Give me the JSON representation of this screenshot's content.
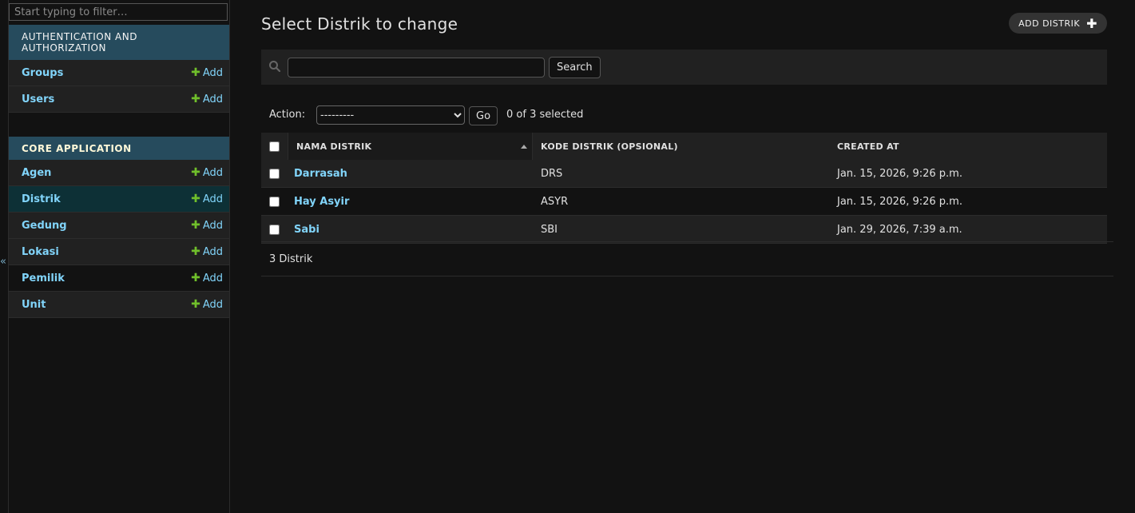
{
  "sidebar": {
    "filter_placeholder": "Start typing to filter…",
    "collapse_glyph": "«",
    "modules": [
      {
        "title": "AUTHENTICATION AND AUTHORIZATION",
        "models": [
          {
            "name": "Groups",
            "add": "Add"
          },
          {
            "name": "Users",
            "add": "Add"
          }
        ]
      },
      {
        "title": "CORE APPLICATION",
        "models": [
          {
            "name": "Agen",
            "add": "Add"
          },
          {
            "name": "Distrik",
            "add": "Add",
            "current": true
          },
          {
            "name": "Gedung",
            "add": "Add"
          },
          {
            "name": "Lokasi",
            "add": "Add"
          },
          {
            "name": "Pemilik",
            "add": "Add"
          },
          {
            "name": "Unit",
            "add": "Add"
          }
        ]
      }
    ]
  },
  "main": {
    "title": "Select Distrik to change",
    "add_button": "ADD DISTRIK",
    "search_button": "Search",
    "action_label": "Action:",
    "action_selected": "---------",
    "go_button": "Go",
    "selected_count": "0 of 3 selected",
    "columns": [
      "NAMA DISTRIK",
      "KODE DISTRIK (OPSIONAL)",
      "CREATED AT"
    ],
    "rows": [
      {
        "nama": "Darrasah",
        "kode": "DRS",
        "created": "Jan. 15, 2026, 9:26 p.m."
      },
      {
        "nama": "Hay Asyir",
        "kode": "ASYR",
        "created": "Jan. 15, 2026, 9:26 p.m."
      },
      {
        "nama": "Sabi",
        "kode": "SBI",
        "created": "Jan. 29, 2026, 7:39 a.m."
      }
    ],
    "paginator": "3 Distrik"
  },
  "colors": {
    "module_header": "#264b5d",
    "link": "#81d4fa",
    "add_plus": "#70bf2b",
    "current_row": "#0d3036"
  }
}
